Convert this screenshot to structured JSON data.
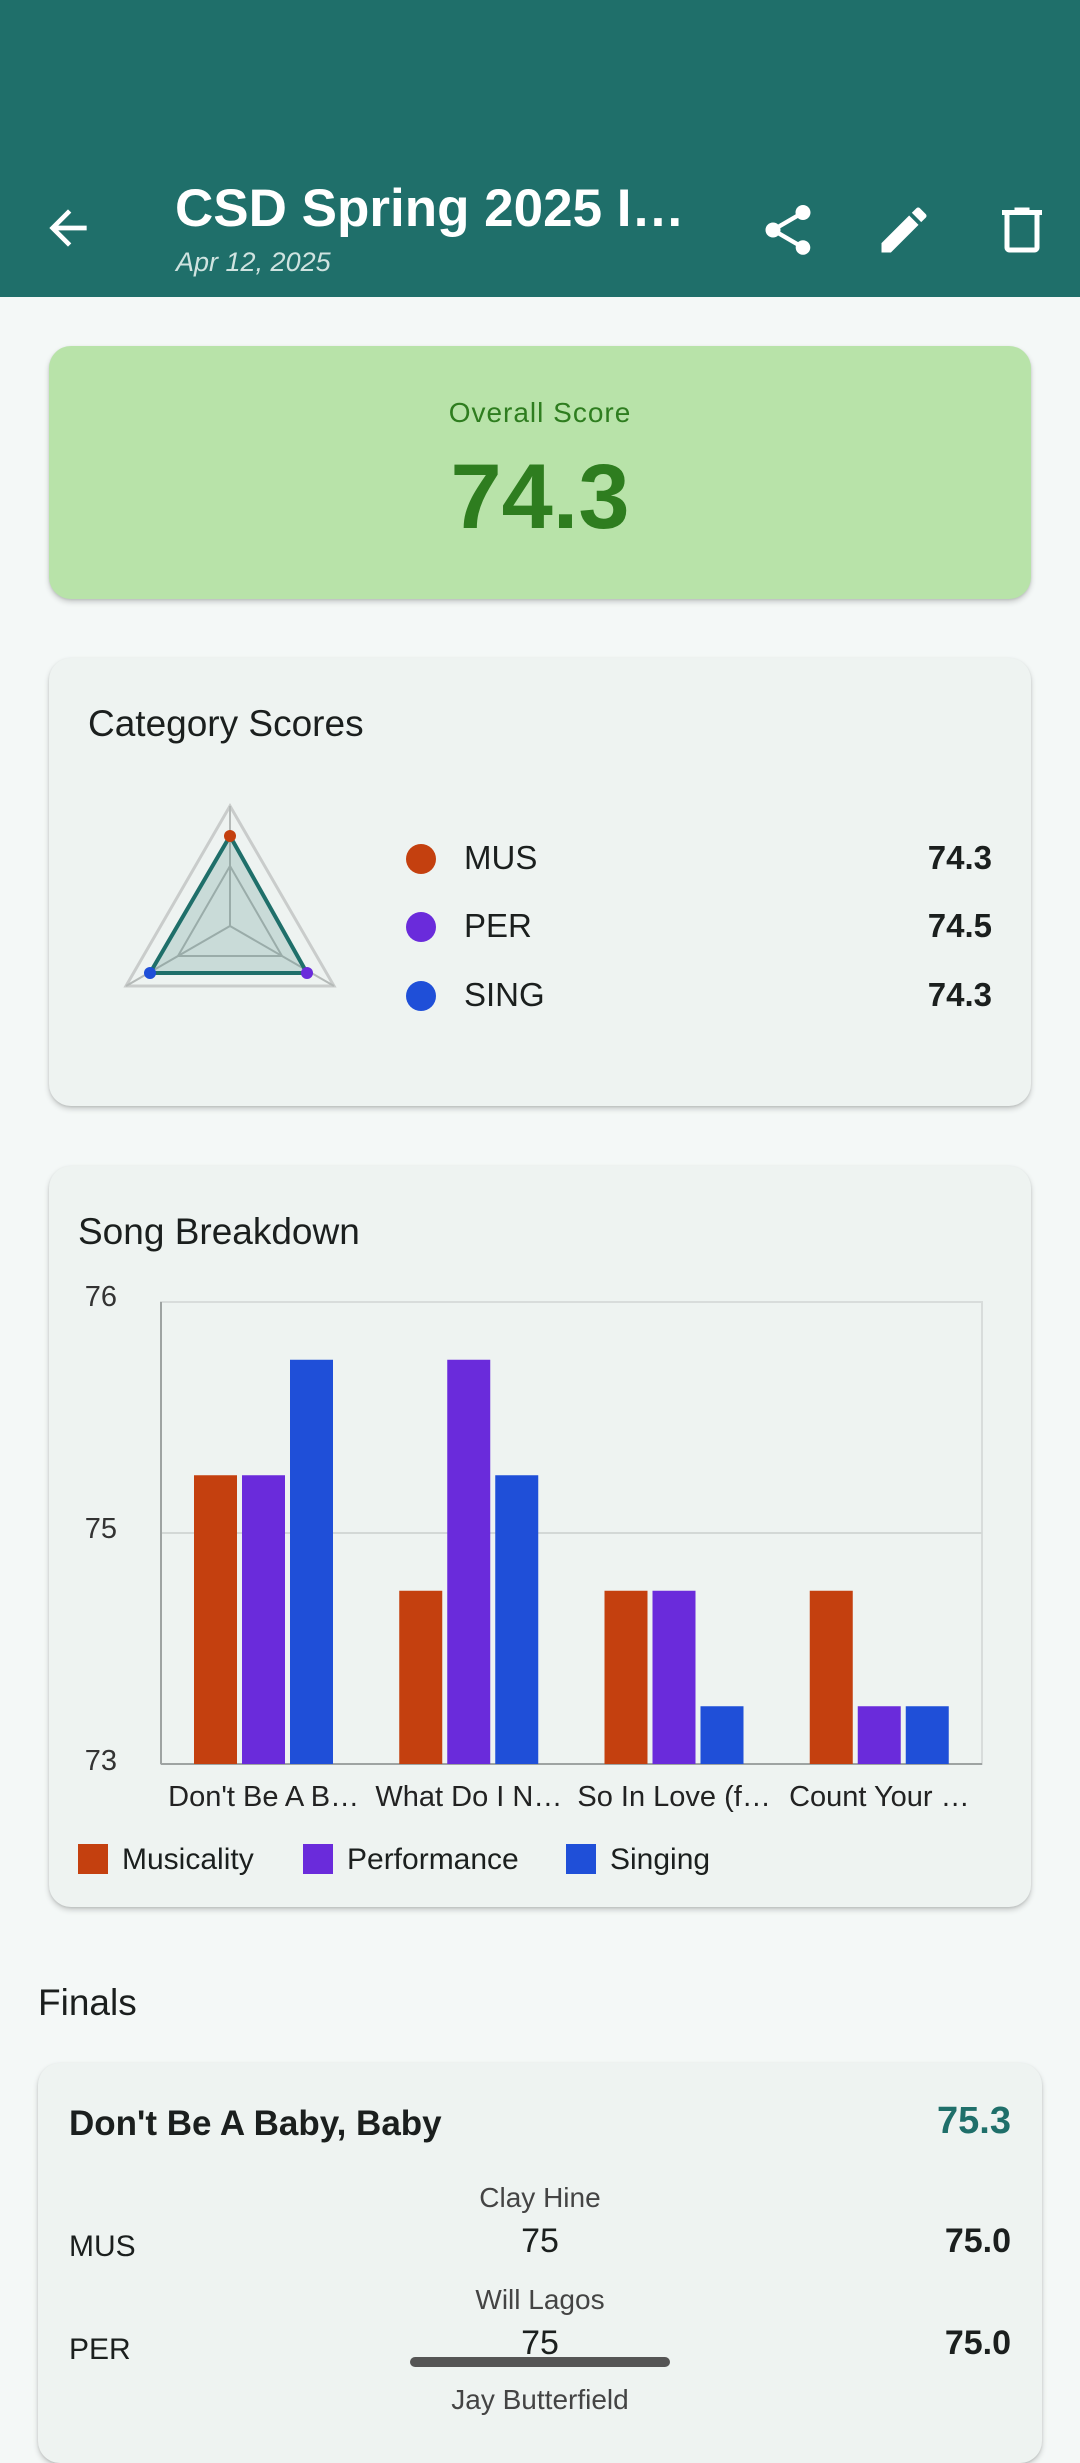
{
  "header": {
    "title": "CSD Spring 2025 In…",
    "subtitle": "Apr 12, 2025",
    "icons": [
      "back-arrow-icon",
      "share-icon",
      "edit-pencil-icon",
      "delete-trash-icon"
    ]
  },
  "overall": {
    "label": "Overall Score",
    "value": "74.3"
  },
  "category_scores": {
    "title": "Category Scores",
    "items": [
      {
        "name": "MUS",
        "value": "74.3",
        "color": "#c4400f"
      },
      {
        "name": "PER",
        "value": "74.5",
        "color": "#6a2bdb"
      },
      {
        "name": "SING",
        "value": "74.3",
        "color": "#1f4fd8"
      }
    ]
  },
  "song_breakdown": {
    "title": "Song Breakdown"
  },
  "chart_data": {
    "type": "bar",
    "title": "Song Breakdown",
    "categories": [
      "Don't Be A B…",
      "What Do I N…",
      "So In Love (f…",
      "Count Your …"
    ],
    "series": [
      {
        "name": "Musicality",
        "color": "#c4400f",
        "values": [
          75.5,
          74.5,
          74.5,
          74.5
        ]
      },
      {
        "name": "Performance",
        "color": "#6a2bdb",
        "values": [
          75.5,
          76.5,
          74.5,
          73.5
        ]
      },
      {
        "name": "Singing",
        "color": "#1f4fd8",
        "values": [
          76.5,
          75.5,
          73.5,
          73.5
        ]
      }
    ],
    "ytick_labels": [
      "76",
      "75",
      "73"
    ],
    "ylim": [
      73,
      77
    ],
    "grid": true,
    "legend": "bottom-left"
  },
  "finals": {
    "title": "Finals",
    "song": {
      "name": "Don't Be A Baby, Baby",
      "score": "75.3",
      "rows": [
        {
          "category": "MUS",
          "judge": "Clay Hine",
          "judge_score": "75",
          "total": "75.0"
        },
        {
          "category": "PER",
          "judge": "Will Lagos",
          "judge_score": "75",
          "total": "75.0"
        }
      ],
      "next_judge": "Jay Butterfield"
    }
  }
}
